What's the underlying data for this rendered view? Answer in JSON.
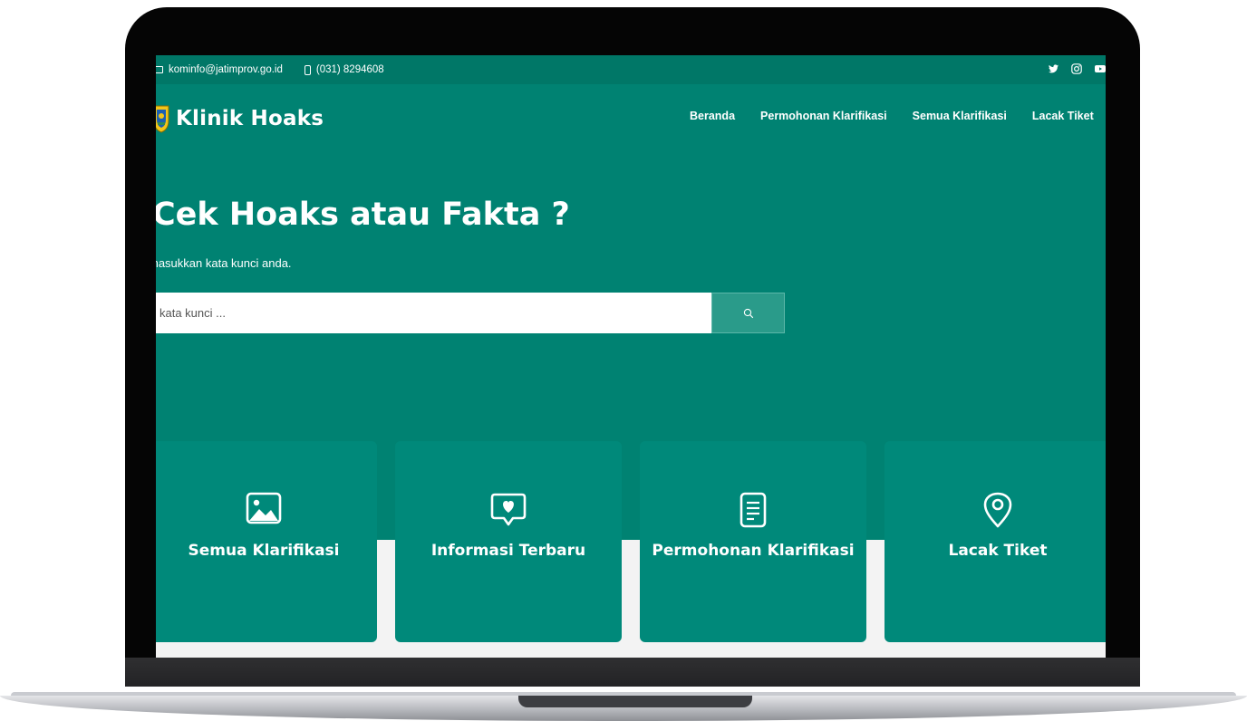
{
  "topbar": {
    "email": "kominfo@jatimprov.go.id",
    "phone": "(031) 8294608",
    "social": [
      "twitter-icon",
      "instagram-icon",
      "youtube-icon"
    ]
  },
  "brand": {
    "name": "Klinik Hoaks",
    "logo": "jatim-emblem-logo"
  },
  "nav": {
    "items": [
      "Beranda",
      "Permohonan Klarifikasi",
      "Semua Klarifikasi",
      "Lacak Tiket"
    ]
  },
  "hero": {
    "title": "Cek Hoaks atau Fakta ?",
    "subtitle": "masukkan kata kunci anda.",
    "search_placeholder": "kata kunci ..."
  },
  "cards": [
    {
      "title": "Semua Klarifikasi",
      "icon": "image-icon"
    },
    {
      "title": "Informasi Terbaru",
      "icon": "chat-heart-icon"
    },
    {
      "title": "Permohonan Klarifikasi",
      "icon": "document-icon"
    },
    {
      "title": "Lacak Tiket",
      "icon": "location-pin-icon"
    }
  ],
  "colors": {
    "primary": "#008272",
    "topbar": "#007767",
    "card": "#00897a",
    "search_button": "#2a9b8a",
    "frame": "#050505"
  }
}
